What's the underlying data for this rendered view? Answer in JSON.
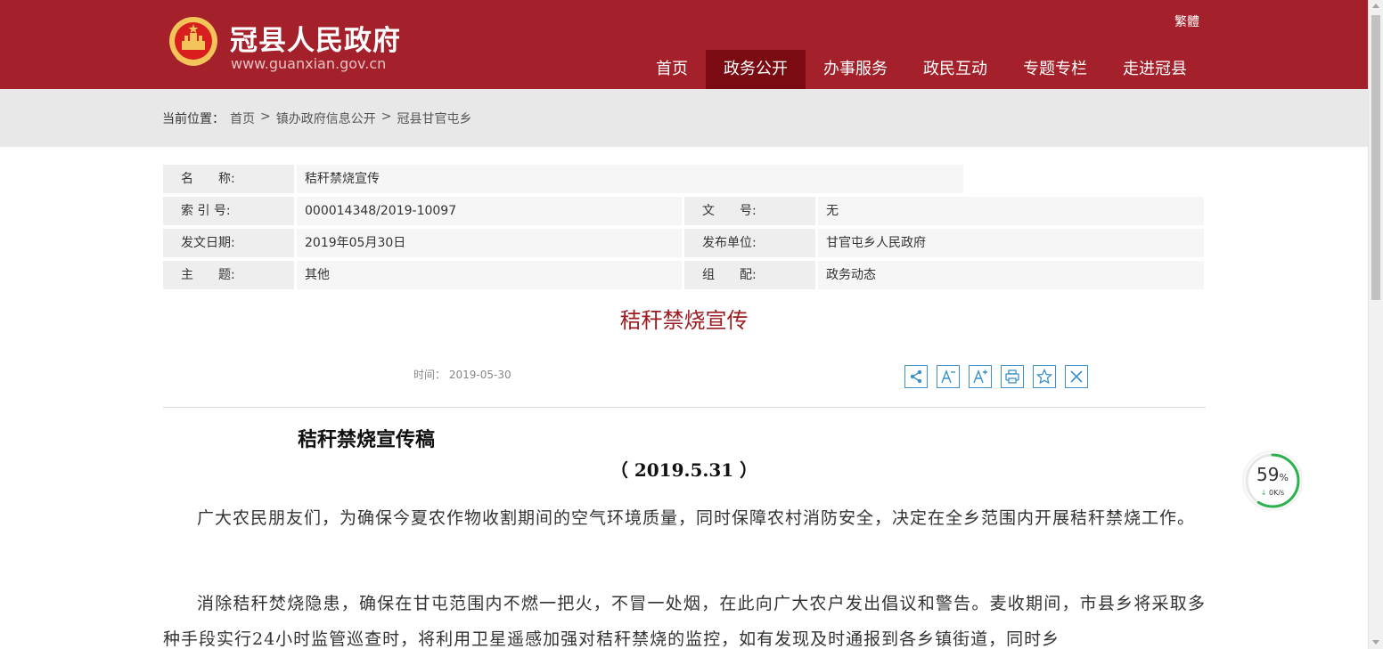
{
  "header": {
    "site_title": "冠县人民政府",
    "site_url": "www.guanxian.gov.cn",
    "lang_link": "繁體",
    "brand_color": "#a4202a",
    "nav": [
      {
        "label": "首页",
        "active": false
      },
      {
        "label": "政务公开",
        "active": true
      },
      {
        "label": "办事服务",
        "active": false
      },
      {
        "label": "政民互动",
        "active": false
      },
      {
        "label": "专题专栏",
        "active": false
      },
      {
        "label": "走进冠县",
        "active": false
      }
    ]
  },
  "breadcrumb": {
    "lead": "当前位置：",
    "items": [
      "首页",
      "镇办政府信息公开",
      "冠县甘官屯乡"
    ],
    "separator": ">"
  },
  "info": {
    "name_label": "名　　称:",
    "name_value": "秸秆禁烧宣传",
    "index_label": "索 引 号:",
    "index_value": "000014348/2019-10097",
    "doc_label": "文　　号:",
    "doc_value": "无",
    "date_label": "发文日期:",
    "date_value": "2019年05月30日",
    "unit_label": "发布单位:",
    "unit_value": "甘官屯乡人民政府",
    "topic_label": "主　　题:",
    "topic_value": "其他",
    "config_label": "组　　配:",
    "config_value": "政务动态"
  },
  "article": {
    "title": "秸秆禁烧宣传",
    "time_label": "时间：",
    "time_value": "2019-05-30",
    "tools": [
      {
        "icon": "share-icon"
      },
      {
        "icon": "font-decrease-icon"
      },
      {
        "icon": "font-increase-icon"
      },
      {
        "icon": "print-icon"
      },
      {
        "icon": "star-icon"
      },
      {
        "icon": "close-icon"
      }
    ],
    "heading": "秸秆禁烧宣传稿",
    "subheading": "（ 2019.5.31 ）",
    "paragraphs": [
      "广大农民朋友们，为确保今夏农作物收割期间的空气环境质量，同时保障农村消防安全，决定在全乡范围内开展秸秆禁烧工作。",
      "消除秸秆焚烧隐患，确保在甘屯范围内不燃一把火，不冒一处烟，在此向广大农户发出倡议和警告。麦收期间，市县乡将采取多种手段实行24小时监管巡查时，将利用卫星遥感加强对秸秆禁烧的监控，如有发现及时通报到各乡镇街道，同时乡"
    ]
  },
  "speed_widget": {
    "percent": "59",
    "percent_unit": "%",
    "rate": "0K/s",
    "fraction": 0.59,
    "ring_color": "#2bb24c"
  }
}
